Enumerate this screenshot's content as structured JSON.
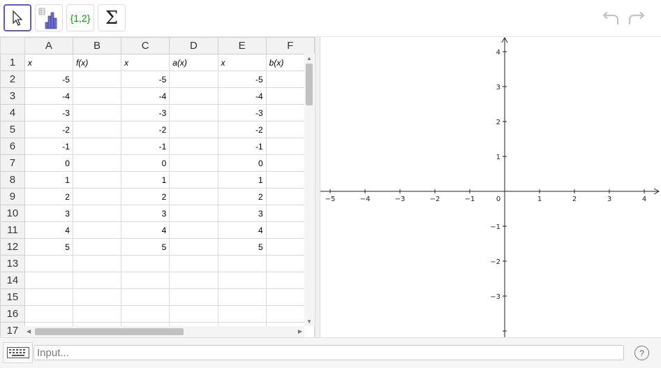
{
  "toolbar": {
    "list_label": "{1,2}",
    "sum_label": "Σ"
  },
  "icons": {
    "move": "pointer-arrow-icon",
    "chart": "bar-chart-icon",
    "undo": "undo-icon",
    "redo": "redo-icon",
    "keyboard": "keyboard-icon",
    "help": "help-icon"
  },
  "sheet": {
    "columns": [
      "A",
      "B",
      "C",
      "D",
      "E",
      "F"
    ],
    "rows": [
      "1",
      "2",
      "3",
      "4",
      "5",
      "6",
      "7",
      "8",
      "9",
      "10",
      "11",
      "12",
      "13",
      "14",
      "15",
      "16",
      "17"
    ],
    "cells": [
      [
        "x",
        "f(x)",
        "x",
        "a(x)",
        "x",
        "b(x)"
      ],
      [
        "-5",
        "",
        "-5",
        "",
        "-5",
        ""
      ],
      [
        "-4",
        "",
        "-4",
        "",
        "-4",
        ""
      ],
      [
        "-3",
        "",
        "-3",
        "",
        "-3",
        ""
      ],
      [
        "-2",
        "",
        "-2",
        "",
        "-2",
        ""
      ],
      [
        "-1",
        "",
        "-1",
        "",
        "-1",
        ""
      ],
      [
        "0",
        "",
        "0",
        "",
        "0",
        ""
      ],
      [
        "1",
        "",
        "1",
        "",
        "1",
        ""
      ],
      [
        "2",
        "",
        "2",
        "",
        "2",
        ""
      ],
      [
        "3",
        "",
        "3",
        "",
        "3",
        ""
      ],
      [
        "4",
        "",
        "4",
        "",
        "4",
        ""
      ],
      [
        "5",
        "",
        "5",
        "",
        "5",
        ""
      ],
      [
        "",
        "",
        "",
        "",
        "",
        ""
      ],
      [
        "",
        "",
        "",
        "",
        "",
        ""
      ],
      [
        "",
        "",
        "",
        "",
        "",
        ""
      ],
      [
        "",
        "",
        "",
        "",
        "",
        ""
      ],
      [
        "",
        "",
        "",
        "",
        "",
        ""
      ]
    ]
  },
  "graphics": {
    "x_ticks": [
      "−5",
      "−4",
      "−3",
      "−2",
      "−1",
      "0",
      "1",
      "2",
      "3",
      "4"
    ],
    "y_ticks_pos": [
      "4",
      "3",
      "2",
      "1"
    ],
    "y_ticks_neg": [
      "−1",
      "−2",
      "−3"
    ]
  },
  "input": {
    "placeholder": "Input..."
  },
  "help": {
    "label": "?"
  },
  "colors": {
    "accent": "#6557d2",
    "list_green": "#00a000"
  }
}
